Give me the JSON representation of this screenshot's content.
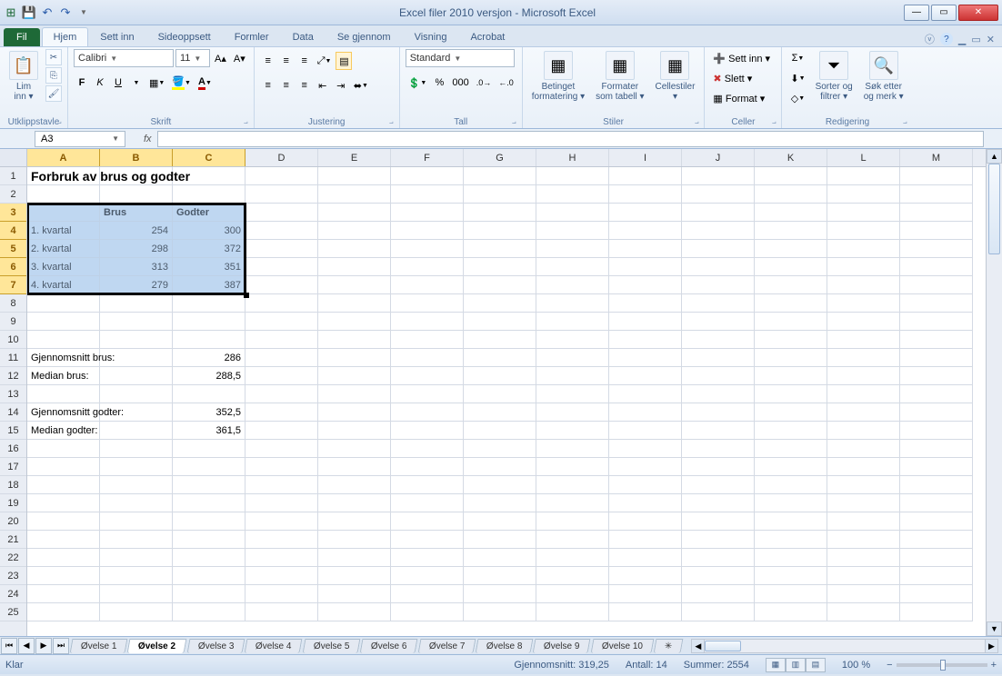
{
  "title": "Excel filer 2010 versjon  -  Microsoft Excel",
  "tabs": {
    "file": "Fil",
    "home": "Hjem",
    "insert": "Sett inn",
    "layout": "Sideoppsett",
    "formulas": "Formler",
    "data": "Data",
    "review": "Se gjennom",
    "view": "Visning",
    "acrobat": "Acrobat"
  },
  "ribbon": {
    "clipboard": {
      "paste": "Lim\ninn ▾",
      "label": "Utklippstavle"
    },
    "font": {
      "name": "Calibri",
      "size": "11",
      "label": "Skrift",
      "bold": "F",
      "italic": "K",
      "underline": "U"
    },
    "align": {
      "label": "Justering"
    },
    "number": {
      "format": "Standard",
      "label": "Tall"
    },
    "styles": {
      "cond": "Betinget\nformatering ▾",
      "table": "Formater\nsom tabell ▾",
      "cell": "Cellestiler\n▾",
      "label": "Stiler"
    },
    "cells": {
      "insert": "Sett inn ▾",
      "delete": "Slett ▾",
      "format": "Format ▾",
      "label": "Celler"
    },
    "editing": {
      "sort": "Sorter og\nfiltrer ▾",
      "find": "Søk etter\nog merk ▾",
      "label": "Redigering"
    }
  },
  "namebox": "A3",
  "columns": [
    "A",
    "B",
    "C",
    "D",
    "E",
    "F",
    "G",
    "H",
    "I",
    "J",
    "K",
    "L",
    "M"
  ],
  "rows_visible": 25,
  "worksheet": {
    "title_cell": "Forbruk av brus og godter",
    "headers": {
      "brus": "Brus",
      "godter": "Godter"
    },
    "data": [
      {
        "label": "1. kvartal",
        "brus": "254",
        "godter": "300"
      },
      {
        "label": "2. kvartal",
        "brus": "298",
        "godter": "372"
      },
      {
        "label": "3. kvartal",
        "brus": "313",
        "godter": "351"
      },
      {
        "label": "4. kvartal",
        "brus": "279",
        "godter": "387"
      }
    ],
    "stats": {
      "avg_brus_label": "Gjennomsnitt brus:",
      "avg_brus": "286",
      "med_brus_label": "Median brus:",
      "med_brus": "288,5",
      "avg_godter_label": "Gjennomsnitt godter:",
      "avg_godter": "352,5",
      "med_godter_label": "Median godter:",
      "med_godter": "361,5"
    }
  },
  "sheets": [
    "Øvelse 1",
    "Øvelse 2",
    "Øvelse 3",
    "Øvelse 4",
    "Øvelse 5",
    "Øvelse 6",
    "Øvelse 7",
    "Øvelse 8",
    "Øvelse 9",
    "Øvelse 10"
  ],
  "active_sheet": 1,
  "status": {
    "ready": "Klar",
    "avg": "Gjennomsnitt: 319,25",
    "count": "Antall: 14",
    "sum": "Summer: 2554",
    "zoom": "100 %"
  }
}
